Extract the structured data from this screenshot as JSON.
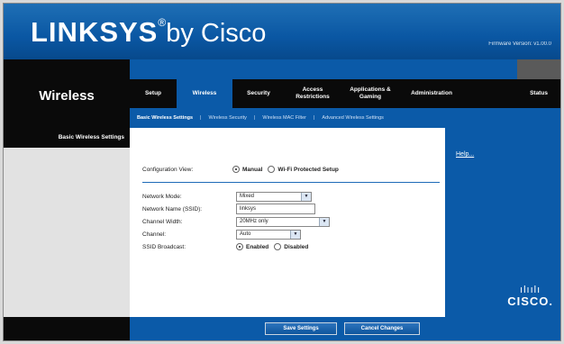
{
  "header": {
    "brand": "LINKSYS",
    "brand_suffix": "by Cisco",
    "firmware": "Firmware Version: v1.00.0"
  },
  "nav": {
    "section": "Wireless",
    "tabs": [
      {
        "label": "Setup"
      },
      {
        "label": "Wireless",
        "active": true
      },
      {
        "label": "Security"
      },
      {
        "label": "Access Restrictions"
      },
      {
        "label": "Applications & Gaming"
      },
      {
        "label": "Administration"
      },
      {
        "label": "Status"
      }
    ],
    "subtabs": [
      {
        "label": "Basic Wireless Settings",
        "active": true
      },
      {
        "label": "Wireless Security"
      },
      {
        "label": "Wireless MAC Filter"
      },
      {
        "label": "Advanced Wireless Settings"
      }
    ],
    "separator": "|"
  },
  "left_panel": {
    "title": "Basic Wireless Settings"
  },
  "form": {
    "config_view_label": "Configuration View:",
    "config_view_options": [
      "Manual",
      "Wi-Fi Protected Setup"
    ],
    "config_view_selected": "Manual",
    "network_mode_label": "Network Mode:",
    "network_mode_value": "Mixed",
    "ssid_label": "Network Name (SSID):",
    "ssid_value": "linksys",
    "channel_width_label": "Channel Width:",
    "channel_width_value": "20MHz only",
    "channel_label": "Channel:",
    "channel_value": "Auto",
    "ssid_broadcast_label": "SSID Broadcast:",
    "ssid_broadcast_options": [
      "Enabled",
      "Disabled"
    ],
    "ssid_broadcast_selected": "Enabled"
  },
  "right_panel": {
    "help_link": "Help...",
    "logo_bars": "ılıılı",
    "logo_word": "CISCO."
  },
  "footer": {
    "save_label": "Save Settings",
    "cancel_label": "Cancel Changes"
  },
  "colors": {
    "brand_blue": "#0b5aa8",
    "header_blue": "#1f6fb5",
    "black": "#0a0a0a",
    "left_gray": "#e2e2e2"
  }
}
